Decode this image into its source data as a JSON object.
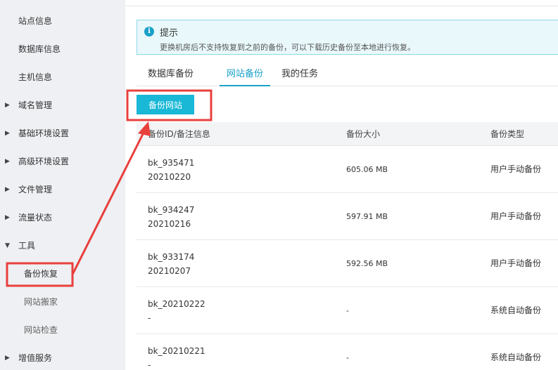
{
  "sidebar": {
    "items": [
      {
        "label": "站点信息"
      },
      {
        "label": "数据库信息"
      },
      {
        "label": "主机信息"
      },
      {
        "label": "域名管理",
        "caret": "▶"
      },
      {
        "label": "基础环境设置",
        "caret": "▶"
      },
      {
        "label": "高级环境设置",
        "caret": "▶"
      },
      {
        "label": "文件管理",
        "caret": "▶"
      },
      {
        "label": "流量状态",
        "caret": "▶"
      },
      {
        "label": "工具",
        "caret": "▼"
      },
      {
        "label": "备份恢复"
      },
      {
        "label": "网站搬家"
      },
      {
        "label": "网站检查"
      },
      {
        "label": "增值服务",
        "caret": "▶"
      }
    ]
  },
  "notice": {
    "icon": "info-icon",
    "icon_glyph": "i",
    "title": "提示",
    "text": "更换机房后不支持恢复到之前的备份，可以下载历史备份至本地进行恢复。"
  },
  "tabs": [
    {
      "label": "数据库备份"
    },
    {
      "label": "网站备份",
      "active": true
    },
    {
      "label": "我的任务"
    }
  ],
  "backup_button": {
    "label": "备份网站"
  },
  "table": {
    "headers": [
      "备份ID/备注信息",
      "备份大小",
      "备份类型"
    ],
    "rows": [
      {
        "id": "bk_935471",
        "note": "20210220",
        "size": "605.06 MB",
        "type": "用户手动备份"
      },
      {
        "id": "bk_934247",
        "note": "20210216",
        "size": "597.91 MB",
        "type": "用户手动备份"
      },
      {
        "id": "bk_933174",
        "note": "20210207",
        "size": "592.56 MB",
        "type": "用户手动备份"
      },
      {
        "id": "bk_20210222",
        "note": "-",
        "size": "-",
        "type": "系统自动备份"
      },
      {
        "id": "bk_20210221",
        "note": "-",
        "size": "-",
        "type": "系统自动备份"
      }
    ]
  },
  "colors": {
    "accent": "#1ba1c9",
    "button": "#18b8d6",
    "annotation": "#e8403c",
    "sidebar_bg": "#eef0f3"
  }
}
